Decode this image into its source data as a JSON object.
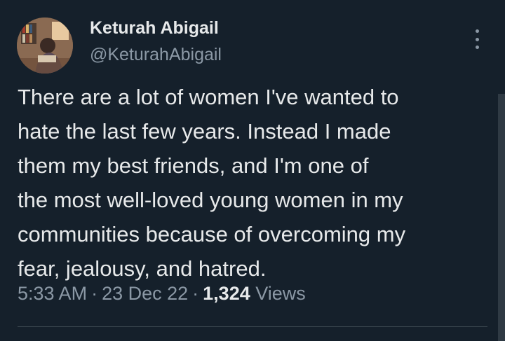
{
  "author": {
    "display_name": "Keturah Abigail",
    "handle": "@KeturahAbigail"
  },
  "tweet": {
    "text_lines": [
      "There are a lot of women I've wanted to",
      "hate the last few years. Instead I made",
      "them my best friends, and I'm one of",
      "the most well-loved young women in my",
      "communities because of overcoming my",
      "fear, jealousy, and hatred."
    ],
    "time": "5:33 AM",
    "date": "23 Dec 22",
    "separator": "·",
    "views_count": "1,324",
    "views_label": "Views"
  },
  "icons": {
    "more": "more-vertical-icon",
    "avatar": "profile-photo"
  },
  "colors": {
    "background": "#15202b",
    "primary_text": "#e7e9ea",
    "secondary_text": "#8b98a5",
    "divider": "#38444d"
  }
}
